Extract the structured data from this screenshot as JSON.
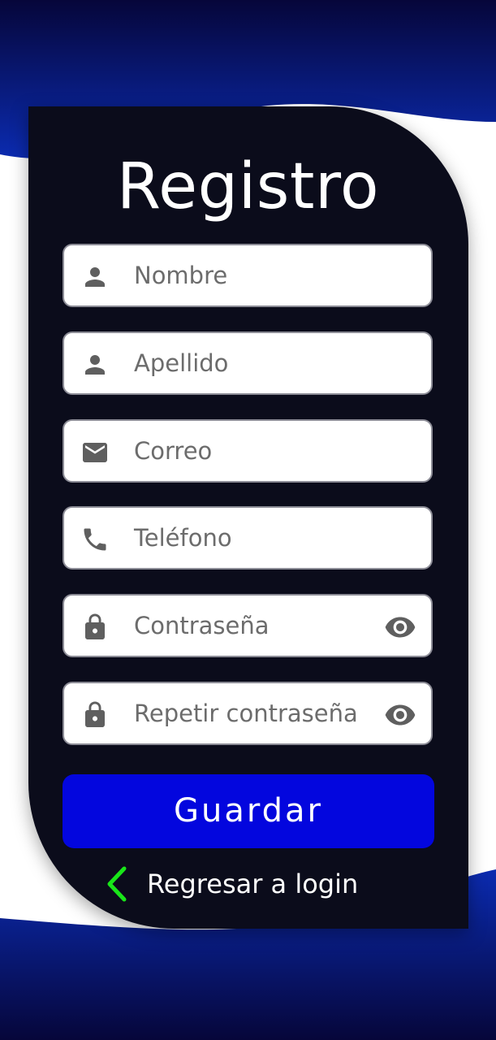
{
  "colors": {
    "background_navy": "#06063a",
    "background_blue": "#0b2bb0",
    "card": "#0b0c1b",
    "field_bg": "#ffffff",
    "icon_gray": "#5f5f5f",
    "button_blue": "#0306de",
    "back_chevron_green": "#19e619"
  },
  "form": {
    "title": "Registro",
    "fields": [
      {
        "placeholder": "Nombre",
        "icon": "person-icon"
      },
      {
        "placeholder": "Apellido",
        "icon": "person-icon"
      },
      {
        "placeholder": "Correo",
        "icon": "mail-icon"
      },
      {
        "placeholder": "Teléfono",
        "icon": "phone-icon"
      },
      {
        "placeholder": "Contraseña",
        "icon": "lock-icon",
        "toggle_icon": "eye-icon"
      },
      {
        "placeholder": "Repetir contraseña",
        "icon": "lock-icon",
        "toggle_icon": "eye-icon"
      }
    ],
    "save_label": "Guardar",
    "back_label": "Regresar a login",
    "back_icon": "chevron-left-icon"
  }
}
